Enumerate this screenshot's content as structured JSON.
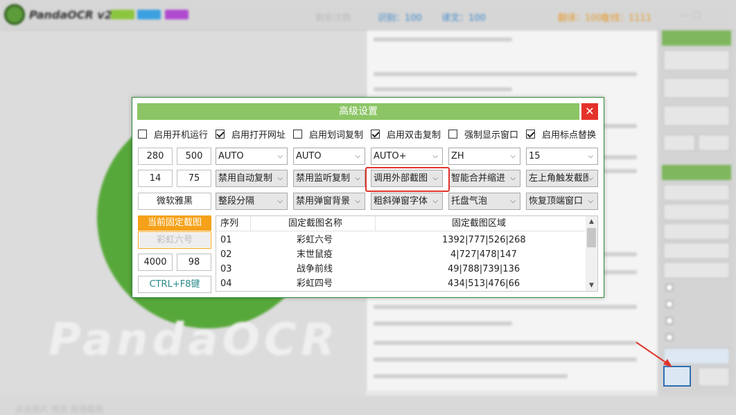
{
  "background": {
    "app_title": "PandaOCR v2.5",
    "stat_labels": [
      "识别：100",
      "译文：100",
      "翻译：1000",
      "在线：1111"
    ],
    "bottom_text": "点击图片 预览 拖拽截图",
    "watermark_text": "PandaOCR"
  },
  "dialog": {
    "title": "高级设置",
    "close_label": "✕",
    "checkboxes": [
      {
        "label": "启用开机运行",
        "checked": false
      },
      {
        "label": "启用打开网址",
        "checked": true
      },
      {
        "label": "启用划词复制",
        "checked": false
      },
      {
        "label": "启用双击复制",
        "checked": true
      },
      {
        "label": "强制显示窗口",
        "checked": false
      },
      {
        "label": "启用标点替换",
        "checked": true
      }
    ],
    "num_fields": {
      "row1_a": "280",
      "row1_b": "500",
      "row2_a": "14",
      "row2_b": "75",
      "row5_a": "4000",
      "row5_b": "98"
    },
    "font_field": "微软雅黑",
    "hotkey_field": "CTRL+F8键",
    "selects": {
      "row1": [
        "AUTO",
        "AUTO",
        "AUTO+",
        "ZH",
        "15"
      ],
      "row2": [
        "禁用自动复制",
        "禁用监听复制",
        "调用外部截图",
        "智能合并缩进",
        "左上角触发截图"
      ],
      "row3": [
        "整段分隔",
        "禁用弹窗背景",
        "粗斜弹窗字体",
        "托盘气泡",
        "恢复顶端窗口"
      ]
    },
    "current_fixed_button": "当前固定截图",
    "current_fixed_name": "彩虹六号",
    "table": {
      "headers": [
        "序列",
        "固定截图名称",
        "固定截图区域"
      ],
      "rows": [
        [
          "01",
          "彩虹六号",
          "1392|777|526|268"
        ],
        [
          "02",
          "末世鼠疫",
          "4|727|478|147"
        ],
        [
          "03",
          "战争前线",
          "49|788|739|136"
        ],
        [
          "04",
          "彩虹四号",
          "434|513|476|66"
        ]
      ]
    }
  },
  "colors": {
    "header_green": "#8bc565",
    "close_red": "#e4322b",
    "orange": "#f5a21a",
    "highlight_red": "#e1332b"
  }
}
